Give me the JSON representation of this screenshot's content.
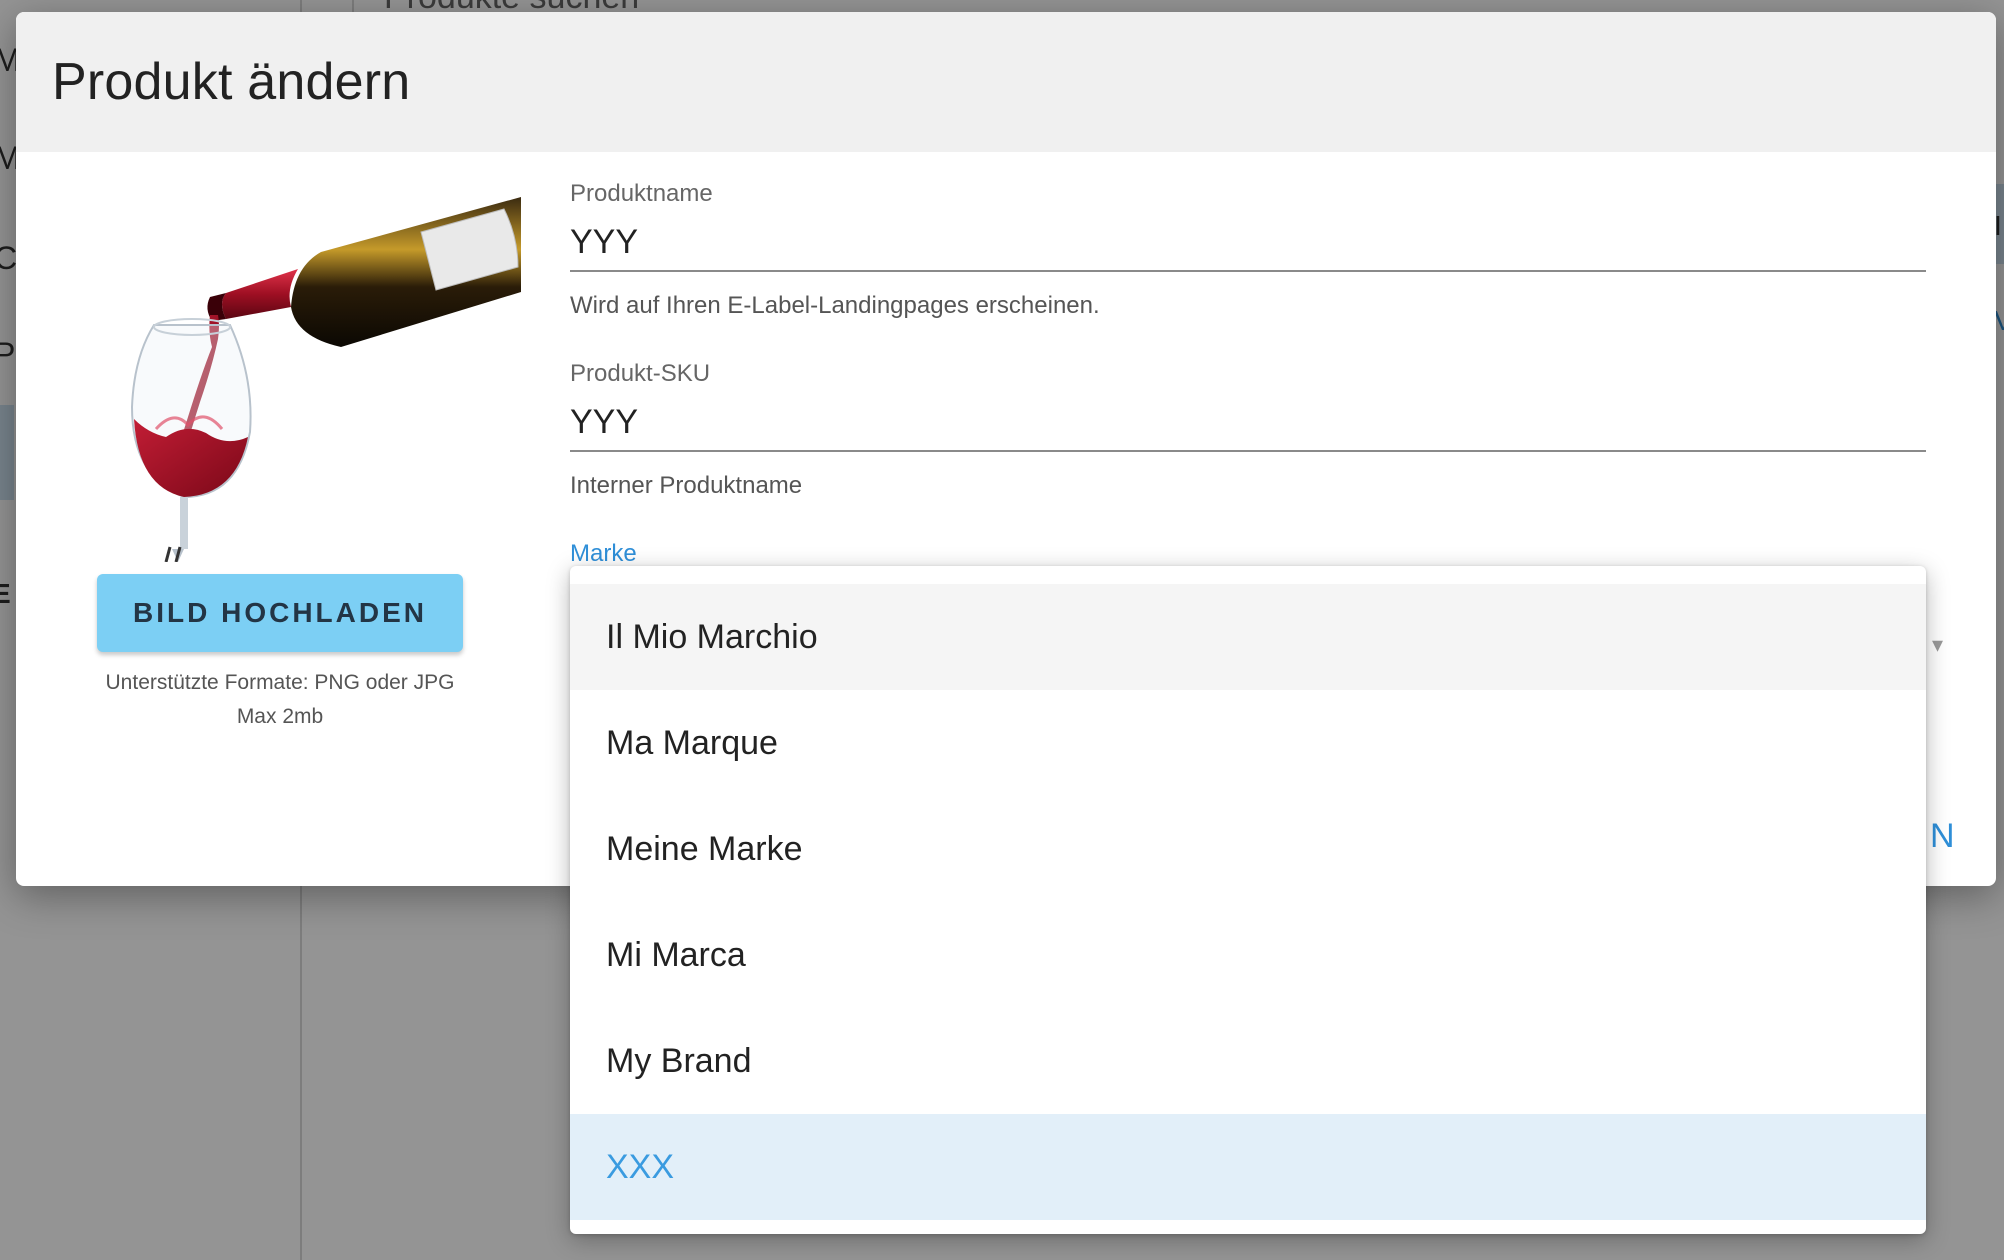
{
  "background": {
    "search_text": "Produkte suchen",
    "sidebar_letters": [
      "M",
      "Ma",
      "Ca",
      "Pr"
    ],
    "sidebar_section": "E",
    "right_glyph": "I",
    "right_glyph_2": "V"
  },
  "dialog": {
    "title": "Produkt ändern",
    "upload_button_label": "BILD HOCHLADEN",
    "upload_hint_line1": "Unterstützte Formate: PNG oder JPG",
    "upload_hint_line2": "Max 2mb",
    "fields": {
      "product_name": {
        "label": "Produktname",
        "value": "YYY",
        "hint": "Wird auf Ihren E-Label-Landingpages erscheinen."
      },
      "product_sku": {
        "label": "Produkt-SKU",
        "value": "YYY",
        "hint": "Interner Produktname"
      },
      "brand": {
        "label": "Marke"
      }
    },
    "hidden_action_fragment": "N"
  },
  "dropdown": {
    "options": [
      "Il Mio Marchio",
      "Ma Marque",
      "Meine Marke",
      "Mi Marca",
      "My Brand",
      "XXX"
    ],
    "hovered": "Il Mio Marchio",
    "selected": "XXX"
  },
  "colors": {
    "accent": "#2f8fd8",
    "upload_button": "#7ccff4",
    "selected_row": "#e2eff9",
    "header": "#f0f0f0"
  }
}
